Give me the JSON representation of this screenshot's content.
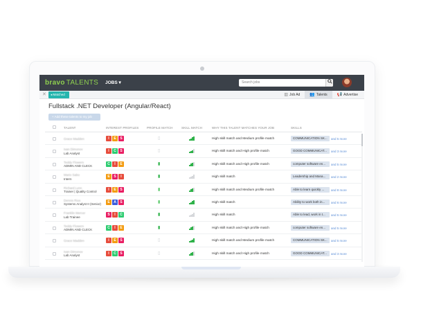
{
  "colors": {
    "topbar": "#3b4149",
    "logo_green": "#8fd14f",
    "accent_teal": "#26b5ae",
    "skill_chip": "#dbe3ee",
    "link_blue": "#5b8ed6",
    "match_green": "#2fb24a"
  },
  "header": {
    "logo_main": "bravo",
    "logo_sub": "TALENTS",
    "jobs_menu": "JOBS ▾",
    "search_placeholder": "Search jobs",
    "search_icon": "search-icon",
    "avatar_caret": "▾"
  },
  "subbar": {
    "chip_label": "◂ Matched",
    "tabs": [
      {
        "label": "Job Ad",
        "icon": "chart-icon",
        "active": false
      },
      {
        "label": "Talents",
        "icon": "people-icon",
        "active": true
      },
      {
        "label": "Advertise",
        "icon": "megaphone-icon",
        "active": false
      }
    ]
  },
  "page": {
    "title": "Fullstack .NET Developer (Angular/React)",
    "add_button": "+ Add these talents to my job"
  },
  "table": {
    "headers": {
      "talent": "TALENT",
      "interest": "INTEREST PROFILES",
      "profile_match": "PROFILE MATCH",
      "skill_match": "SKILL MATCH",
      "why": "WHY THIS TALENT MATCHES YOUR JOB",
      "skills": "SKILLS"
    },
    "rows": [
      {
        "name": "Grace Madden",
        "role": "",
        "letters": [
          "I",
          "E",
          "S"
        ],
        "profile": "low",
        "skill_level": 4,
        "skill_active": true,
        "why": "High skill match and Medium profile match",
        "skill": "COMMUNICATION SK...",
        "more": "and 5 more"
      },
      {
        "name": "Ivan Dimonov",
        "role": "Lab Analyst",
        "letters": [
          "I",
          "C",
          "S"
        ],
        "profile": "low",
        "skill_level": 3,
        "skill_active": true,
        "why": "High skill match and High profile match",
        "skill": "GOOD COMMUNICAT...",
        "more": "and 3 more"
      },
      {
        "name": "Teddy Flowers",
        "role": "ADMIN AND CLECK",
        "letters": [
          "C",
          "I",
          "E"
        ],
        "profile": "high",
        "skill_level": 3,
        "skill_active": true,
        "why": "High skill match and High profile match",
        "skill": "computer software en...",
        "more": "and 5 more"
      },
      {
        "name": "Mario Sabo",
        "role": "Intern",
        "letters": [
          "E",
          "S",
          "I"
        ],
        "profile": "high",
        "skill_level": 0,
        "skill_active": false,
        "why": "High skill match",
        "skill": "Leadership and Mana...",
        "more": "and 2 more"
      },
      {
        "name": "Richard Lynn",
        "role": "Trainer | Quality Control",
        "letters": [
          "I",
          "E",
          "S"
        ],
        "profile": "medium",
        "skill_level": 3,
        "skill_active": true,
        "why": "High skill match and Medium profile match",
        "skill": "Able to learn quickly ...",
        "more": "and 8 more"
      },
      {
        "name": "Dennis Rios",
        "role": "Systems Analyst II (Senior)",
        "letters": [
          "E",
          "A",
          "S"
        ],
        "profile": "medium",
        "skill_level": 4,
        "skill_active": true,
        "why": "High skill match",
        "skill": "Ability to work both in...",
        "more": "and 6 more"
      },
      {
        "name": "Franklin Mercer",
        "role": "Lab Trainee",
        "letters": [
          "S",
          "I",
          "C"
        ],
        "profile": "high",
        "skill_level": 0,
        "skill_active": false,
        "why": "High skill match",
        "skill": "Able to lead, work in t...",
        "more": "and 5 more"
      },
      {
        "name": "Teddy Flowers",
        "role": "ADMIN AND CLECK",
        "letters": [
          "C",
          "I",
          "E"
        ],
        "profile": "high",
        "skill_level": 3,
        "skill_active": true,
        "why": "High skill match and High profile match",
        "skill": "computer software en...",
        "more": "and 5 more"
      },
      {
        "name": "Grace Madden",
        "role": "",
        "letters": [
          "I",
          "E",
          "S"
        ],
        "profile": "low",
        "skill_level": 4,
        "skill_active": true,
        "why": "High skill match and Medium profile match",
        "skill": "COMMUNICATION SK...",
        "more": "and 5 more"
      },
      {
        "name": "Ivan Dimonov",
        "role": "Lab Analyst",
        "letters": [
          "I",
          "C",
          "S"
        ],
        "profile": "low",
        "skill_level": 3,
        "skill_active": true,
        "why": "High skill match and High profile match",
        "skill": "GOOD COMMUNICAT...",
        "more": "and 3 more"
      }
    ]
  },
  "letter_colors": {
    "I": "#e74c3c",
    "E": "#f39c12",
    "S": "#e91e63",
    "C": "#2ecc71",
    "A": "#3b5bdb"
  }
}
